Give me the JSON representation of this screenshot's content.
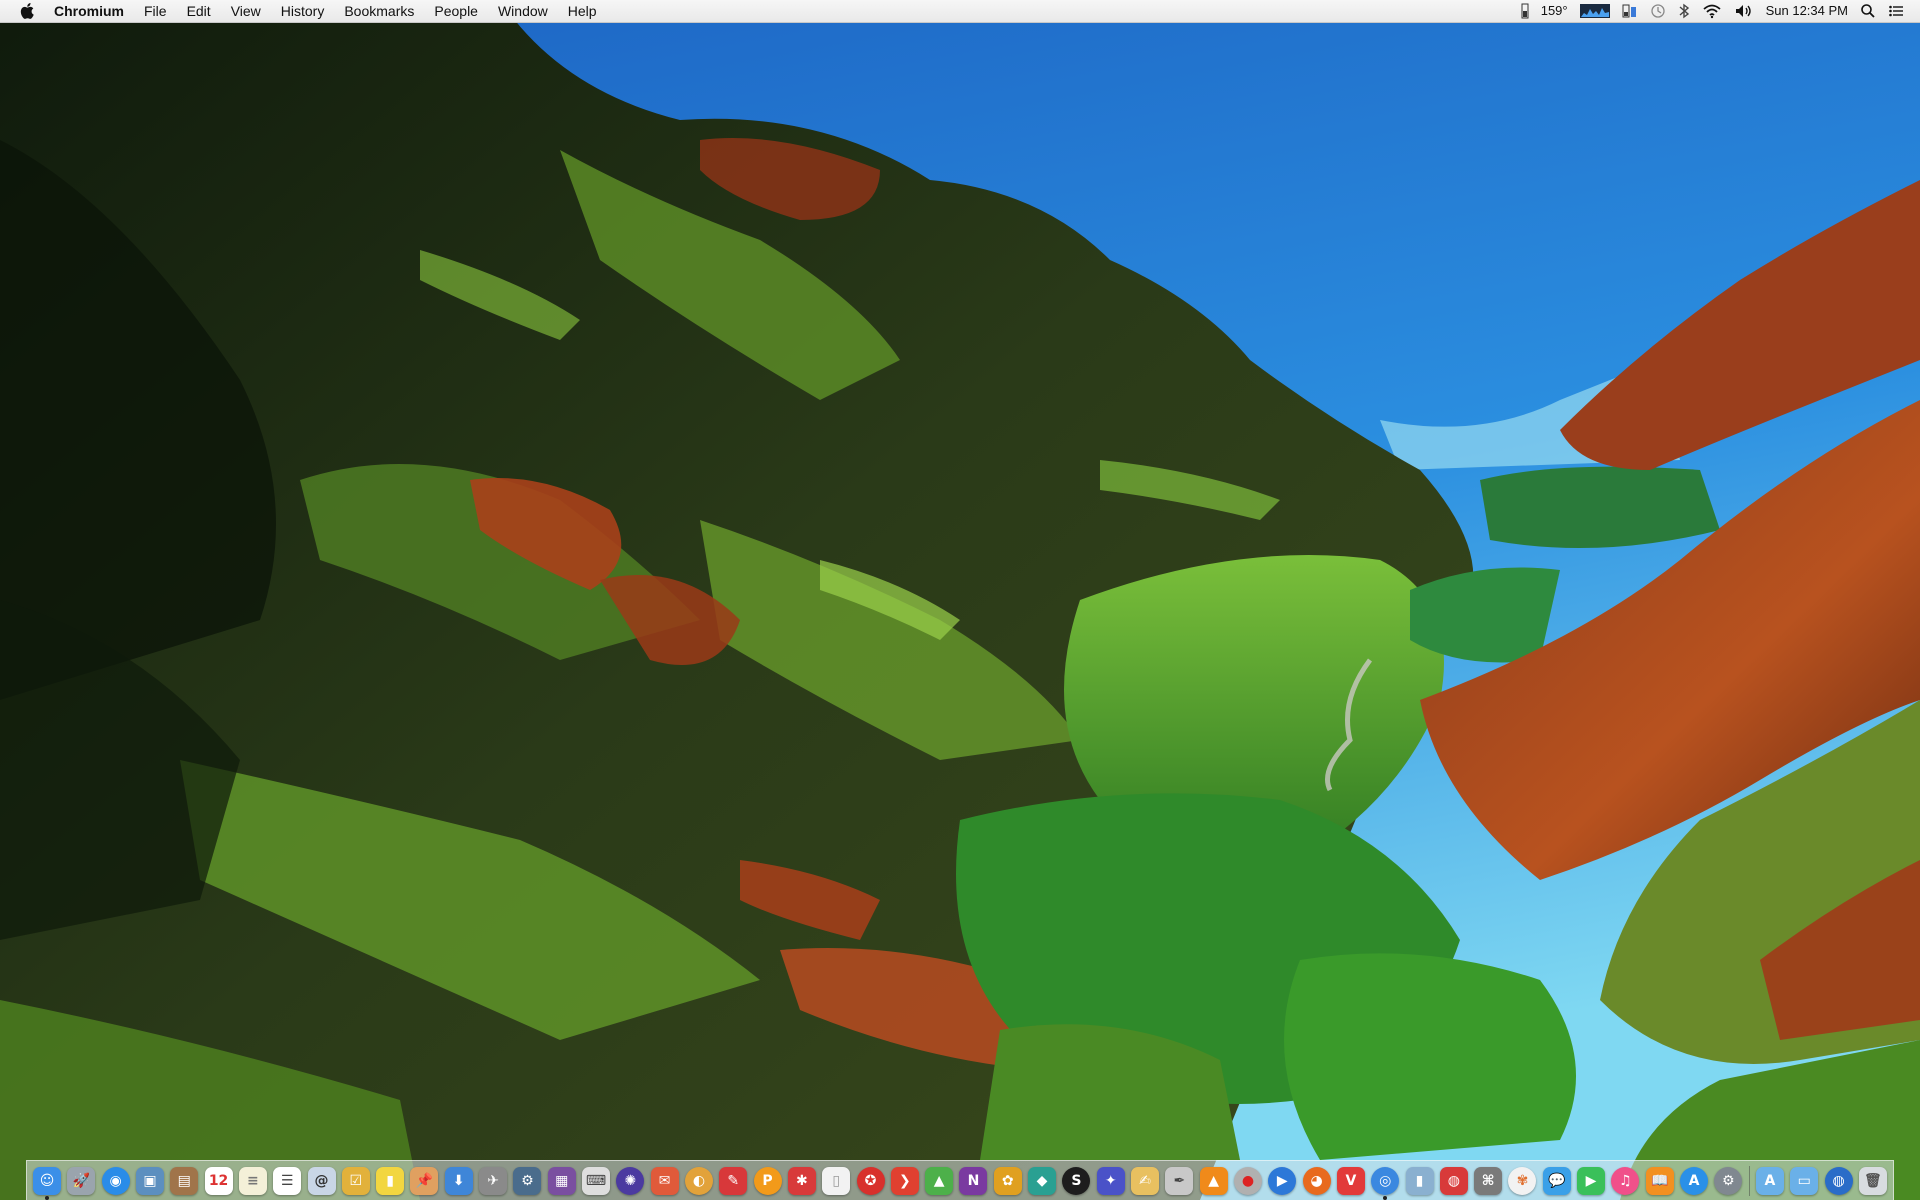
{
  "menubar": {
    "app_name": "Chromium",
    "menus": [
      "File",
      "Edit",
      "View",
      "History",
      "Bookmarks",
      "People",
      "Window",
      "Help"
    ],
    "status": {
      "temperature": "159°",
      "clock": "Sun 12:34 PM"
    },
    "icons": [
      "apple-logo-icon",
      "memory-monitor-icon",
      "cpu-graph-icon",
      "battery-icon",
      "time-machine-icon",
      "bluetooth-icon",
      "wifi-icon",
      "volume-icon",
      "spotlight-icon",
      "notification-center-icon"
    ]
  },
  "dock": {
    "apps": [
      {
        "name": "finder",
        "glyph": "☺",
        "color": "#3b8fe8",
        "running": true
      },
      {
        "name": "launchpad",
        "glyph": "🚀",
        "color": "#9aa4ad"
      },
      {
        "name": "safari",
        "glyph": "◉",
        "color": "#2a8ce8",
        "round": true
      },
      {
        "name": "preview",
        "glyph": "▣",
        "color": "#5c8fbf"
      },
      {
        "name": "notebook",
        "glyph": "▤",
        "color": "#a0744a"
      },
      {
        "name": "calendar",
        "glyph": "12",
        "color": "#ffffff",
        "text_color": "#d33"
      },
      {
        "name": "notes",
        "glyph": "≡",
        "color": "#f4f0d8",
        "text_color": "#777"
      },
      {
        "name": "reminders",
        "glyph": "☰",
        "color": "#ffffff",
        "text_color": "#444"
      },
      {
        "name": "contacts",
        "glyph": "@",
        "color": "#c9d6e6",
        "text_color": "#333"
      },
      {
        "name": "todo",
        "glyph": "☑",
        "color": "#e2b13b"
      },
      {
        "name": "stickies",
        "glyph": "▮",
        "color": "#f2d640"
      },
      {
        "name": "pin",
        "glyph": "📌",
        "color": "#e0a060"
      },
      {
        "name": "downloads",
        "glyph": "⬇",
        "color": "#3f86d8"
      },
      {
        "name": "plane",
        "glyph": "✈",
        "color": "#8a8a8a"
      },
      {
        "name": "toolbox",
        "glyph": "⚙",
        "color": "#4a6c8c"
      },
      {
        "name": "photo-slideshow",
        "glyph": "▦",
        "color": "#7a4fa0"
      },
      {
        "name": "keyboard",
        "glyph": "⌨",
        "color": "#dedede",
        "text_color": "#444"
      },
      {
        "name": "dashboard",
        "glyph": "✺",
        "color": "#4b3aa0",
        "round": true
      },
      {
        "name": "airmail",
        "glyph": "✉",
        "color": "#e05a3a"
      },
      {
        "name": "colorsync",
        "glyph": "◐",
        "color": "#e2a23a",
        "round": true
      },
      {
        "name": "pushpin-red",
        "glyph": "✎",
        "color": "#d8383a"
      },
      {
        "name": "pages",
        "glyph": "P",
        "color": "#f29a1a",
        "round": true
      },
      {
        "name": "gift",
        "glyph": "✱",
        "color": "#d83a3a"
      },
      {
        "name": "blank-doc",
        "glyph": "▯",
        "color": "#f2f2f2",
        "text_color": "#999"
      },
      {
        "name": "flash",
        "glyph": "✪",
        "color": "#d8302c",
        "round": true
      },
      {
        "name": "mango",
        "glyph": "❯",
        "color": "#e04030"
      },
      {
        "name": "photo-viewer",
        "glyph": "▲",
        "color": "#4db04a"
      },
      {
        "name": "onenote",
        "glyph": "N",
        "color": "#7a3aa0"
      },
      {
        "name": "bug",
        "glyph": "✿",
        "color": "#e0a020"
      },
      {
        "name": "dropbox-like",
        "glyph": "◆",
        "color": "#2aa092"
      },
      {
        "name": "scrivener",
        "glyph": "S",
        "color": "#1d1d1d",
        "round": true
      },
      {
        "name": "paint",
        "glyph": "✦",
        "color": "#4a52c8"
      },
      {
        "name": "textedit",
        "glyph": "✍",
        "color": "#e8c060"
      },
      {
        "name": "script-editor",
        "glyph": "✒",
        "color": "#c8c8c8",
        "text_color": "#444"
      },
      {
        "name": "vlc",
        "glyph": "▲",
        "color": "#f08a1a"
      },
      {
        "name": "record",
        "glyph": "●",
        "color": "#b0b0b0",
        "text_color": "#d22",
        "round": true
      },
      {
        "name": "quicktime",
        "glyph": "▶",
        "color": "#2c78d8",
        "round": true
      },
      {
        "name": "firefox",
        "glyph": "◕",
        "color": "#e86a1e",
        "round": true
      },
      {
        "name": "vivaldi",
        "glyph": "V",
        "color": "#e23a3a"
      },
      {
        "name": "chromium",
        "glyph": "◎",
        "color": "#3a88e0",
        "round": true,
        "running": true
      },
      {
        "name": "bottle",
        "glyph": "▮",
        "color": "#8ab0d0"
      },
      {
        "name": "photo-booth",
        "glyph": "◍",
        "color": "#d83a3a"
      },
      {
        "name": "utility",
        "glyph": "⌘",
        "color": "#7a7a7a"
      },
      {
        "name": "photos",
        "glyph": "✾",
        "color": "#f2f2f2",
        "text_color": "#e07030",
        "round": true
      },
      {
        "name": "messages",
        "glyph": "💬",
        "color": "#3aa0e8"
      },
      {
        "name": "facetime",
        "glyph": "▶",
        "color": "#3ac05a"
      },
      {
        "name": "itunes",
        "glyph": "♫",
        "color": "#f0508a",
        "round": true
      },
      {
        "name": "ibooks",
        "glyph": "📖",
        "color": "#f29020"
      },
      {
        "name": "app-store",
        "glyph": "A",
        "color": "#2a90e8",
        "round": true
      },
      {
        "name": "system-preferences",
        "glyph": "⚙",
        "color": "#808890",
        "round": true
      },
      {
        "separator": true
      },
      {
        "name": "applications-folder",
        "glyph": "A",
        "color": "#6ab0e8"
      },
      {
        "name": "documents-folder",
        "glyph": "▭",
        "color": "#6ab0e8"
      },
      {
        "name": "globe-downloads",
        "glyph": "◍",
        "color": "#2a6cc8",
        "round": true
      },
      {
        "name": "trash",
        "glyph": "🗑",
        "color": "#d8dce0",
        "text_color": "#555"
      }
    ]
  }
}
